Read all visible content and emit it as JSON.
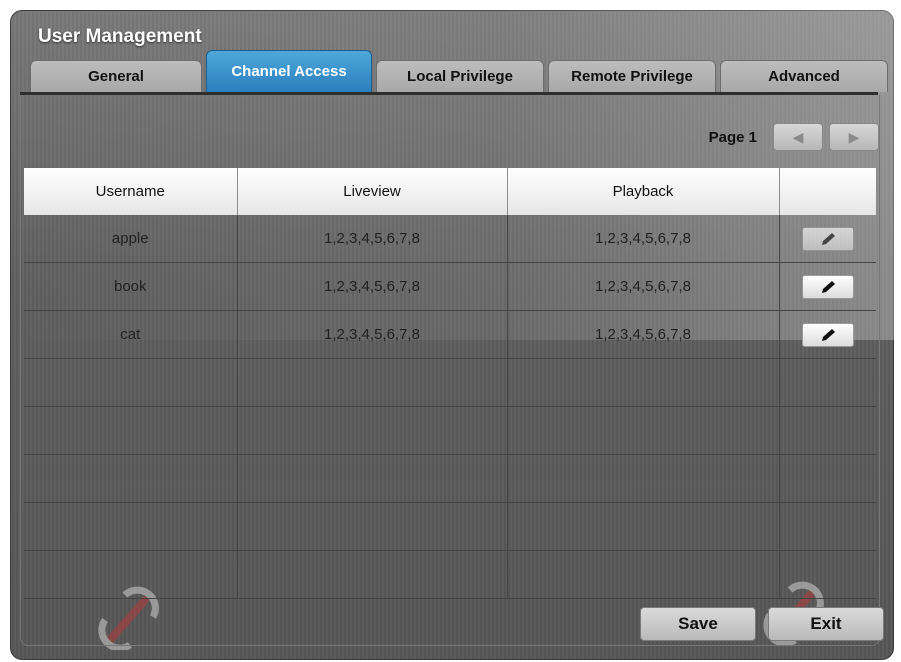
{
  "window": {
    "title": "User Management"
  },
  "tabs": [
    {
      "label": "General",
      "active": false
    },
    {
      "label": "Channel Access",
      "active": true
    },
    {
      "label": "Local Privilege",
      "active": false
    },
    {
      "label": "Remote Privilege",
      "active": false
    },
    {
      "label": "Advanced",
      "active": false
    }
  ],
  "pager": {
    "label": "Page 1",
    "prev_icon": "triangle-left-icon",
    "next_icon": "triangle-right-icon"
  },
  "table": {
    "headers": [
      "Username",
      "Liveview",
      "Playback",
      ""
    ],
    "rows": [
      {
        "username": "apple",
        "liveview": "1,2,3,4,5,6,7,8",
        "playback": "1,2,3,4,5,6,7,8",
        "edit_icon": "pencil-icon"
      },
      {
        "username": "book",
        "liveview": "1,2,3,4,5,6,7,8",
        "playback": "1,2,3,4,5,6,7,8",
        "edit_icon": "pencil-icon"
      },
      {
        "username": "cat",
        "liveview": "1,2,3,4,5,6,7,8",
        "playback": "1,2,3,4,5,6,7,8",
        "edit_icon": "pencil-icon"
      },
      {
        "username": "",
        "liveview": "",
        "playback": ""
      },
      {
        "username": "",
        "liveview": "",
        "playback": ""
      },
      {
        "username": "",
        "liveview": "",
        "playback": ""
      },
      {
        "username": "",
        "liveview": "",
        "playback": ""
      },
      {
        "username": "",
        "liveview": "",
        "playback": ""
      }
    ]
  },
  "buttons": {
    "save": "Save",
    "exit": "Exit"
  },
  "colors": {
    "active_tab": "#2b7fbf",
    "panel": "#5e5e5e",
    "header": "#ffffff"
  }
}
